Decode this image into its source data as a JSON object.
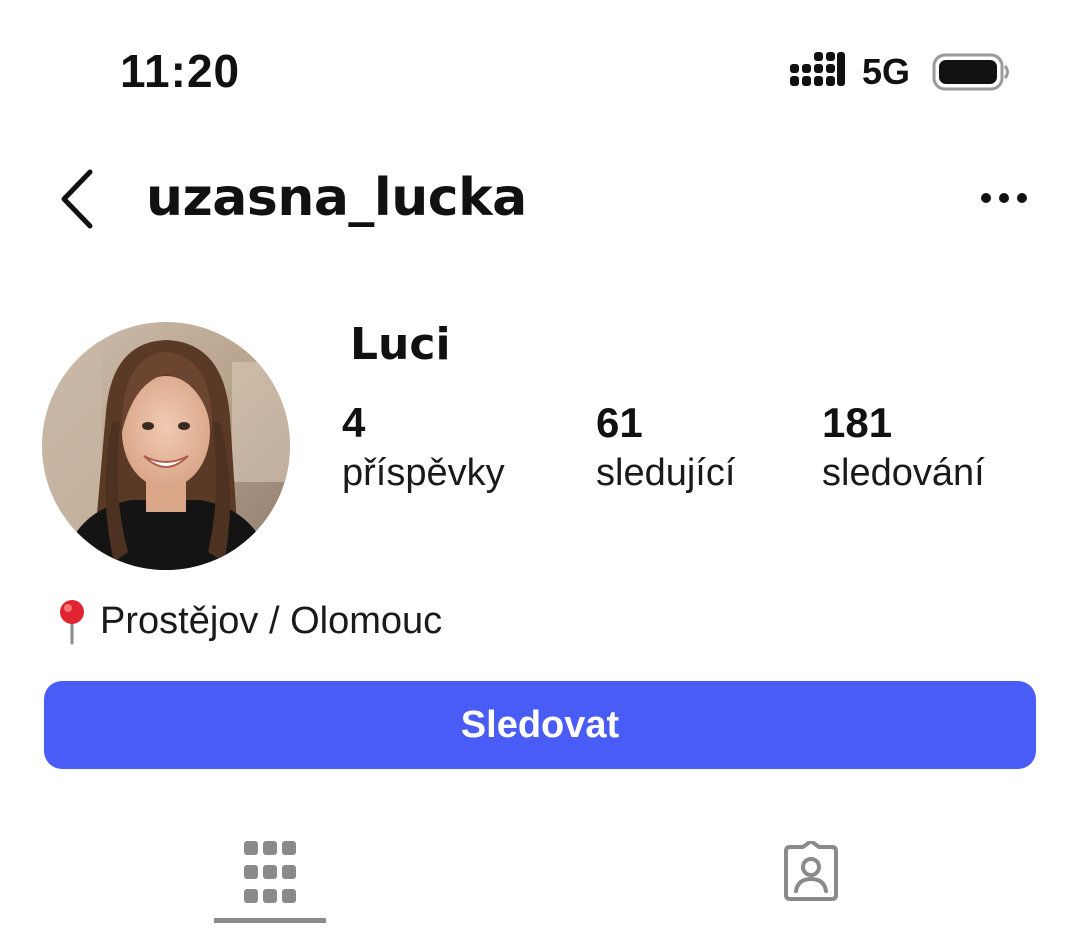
{
  "status_bar": {
    "time": "11:20",
    "network": "5G",
    "signal_icon": "cellular-signal-icon",
    "battery_icon": "battery-icon"
  },
  "header": {
    "username": "uzasna_lucka",
    "back_icon": "chevron-left-icon",
    "more_icon": "more-horizontal-icon"
  },
  "profile": {
    "display_name": "Luci",
    "avatar_icon": "avatar",
    "stats": [
      {
        "count": "4",
        "label": "příspěvky"
      },
      {
        "count": "61",
        "label": "sledující"
      },
      {
        "count": "181",
        "label": "sledování"
      }
    ],
    "location_icon": "map-pin-icon",
    "location": "Prostějov / Olomouc"
  },
  "follow_button": {
    "label": "Sledovat",
    "color": "#4a5cf6"
  },
  "tabs": [
    {
      "icon": "grid-icon",
      "active": true
    },
    {
      "icon": "tagged-person-icon",
      "active": false
    }
  ]
}
